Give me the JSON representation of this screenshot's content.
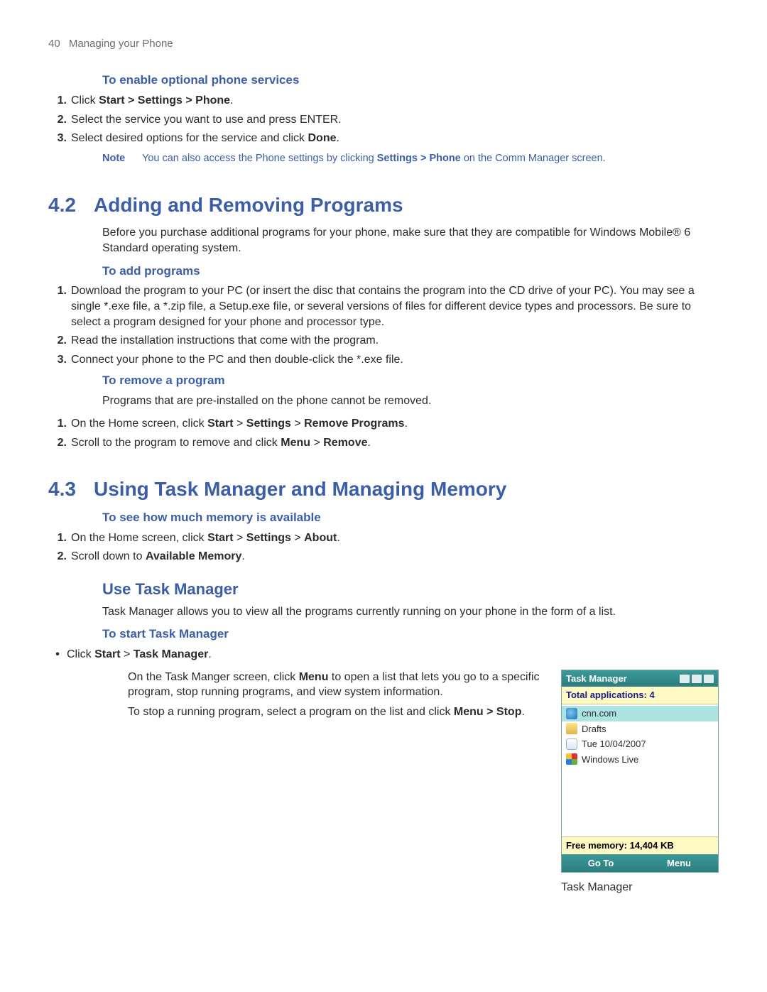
{
  "page": {
    "number": "40",
    "running_title": "Managing your Phone"
  },
  "sec_phone_services": {
    "heading": "To enable optional phone services",
    "steps": [
      {
        "n": "1.",
        "pre": "Click ",
        "bold": "Start > Settings > Phone",
        "post": "."
      },
      {
        "n": "2.",
        "plain": "Select the service you want to use and press ENTER."
      },
      {
        "n": "3.",
        "pre": "Select desired options for the service and click ",
        "bold": "Done",
        "post": "."
      }
    ],
    "note_label": "Note",
    "note_pre": "You can also access the Phone settings by clicking ",
    "note_bold": "Settings > Phone",
    "note_post": " on the Comm Manager screen."
  },
  "sec42": {
    "num": "4.2",
    "title": "Adding and Removing Programs",
    "intro": "Before you purchase additional programs for your phone, make sure that they are compatible for Windows Mobile® 6 Standard operating system.",
    "add_heading": "To add programs",
    "add_steps": [
      {
        "n": "1.",
        "plain": "Download the program to your PC (or insert the disc that contains the program into the CD drive of your PC). You may see a single *.exe file, a *.zip file, a Setup.exe file, or several versions of files for different device types and processors. Be sure to select a program designed for your phone and processor type."
      },
      {
        "n": "2.",
        "plain": "Read the installation instructions that come with the program."
      },
      {
        "n": "3.",
        "plain": "Connect your phone to the PC and then double-click the *.exe file."
      }
    ],
    "remove_heading": "To remove a program",
    "remove_intro": "Programs that are pre-installed on the phone cannot be removed.",
    "remove_steps": [
      {
        "n": "1.",
        "pre": "On the Home screen, click ",
        "bold": "Start",
        "mid1": " > ",
        "bold2": "Settings",
        "mid2": " > ",
        "bold3": "Remove Programs",
        "post": "."
      },
      {
        "n": "2.",
        "pre": "Scroll to the program to remove and click ",
        "bold": "Menu",
        "mid1": " > ",
        "bold2": "Remove",
        "post": "."
      }
    ]
  },
  "sec43": {
    "num": "4.3",
    "title": "Using Task Manager and Managing Memory",
    "mem_heading": "To see how much memory is available",
    "mem_steps": [
      {
        "n": "1.",
        "pre": "On the Home screen, click ",
        "bold": "Start",
        "mid1": " > ",
        "bold2": "Settings",
        "mid2": " > ",
        "bold3": "About",
        "post": "."
      },
      {
        "n": "2.",
        "pre": "Scroll down to ",
        "bold": "Available Memory",
        "post": "."
      }
    ],
    "use_tm_heading": "Use Task Manager",
    "use_tm_intro": "Task Manager allows you to view all the programs currently running on your phone in the form of a list.",
    "start_tm_heading": "To start Task Manager",
    "start_tm_bullet_pre": "Click ",
    "start_tm_bullet_bold": "Start",
    "start_tm_bullet_mid": " > ",
    "start_tm_bullet_bold2": "Task Manager",
    "start_tm_bullet_post": ".",
    "tm_para1_pre": "On the Task Manger screen, click ",
    "tm_para1_bold": "Menu",
    "tm_para1_post": " to open a list that lets you go to a specific program, stop running programs, and view system information.",
    "tm_para2_pre": "To stop a running program, select a program on the list and click ",
    "tm_para2_bold": "Menu > Stop",
    "tm_para2_post": "."
  },
  "screenshot": {
    "title": "Task Manager",
    "total_label": "Total applications: 4",
    "items": [
      {
        "icon": "ie",
        "label": "cnn.com",
        "selected": true
      },
      {
        "icon": "folder",
        "label": "Drafts",
        "selected": false
      },
      {
        "icon": "cal",
        "label": "Tue 10/04/2007",
        "selected": false
      },
      {
        "icon": "flag",
        "label": "Windows Live",
        "selected": false
      }
    ],
    "free_mem": "Free memory: 14,404 KB",
    "softkey_left": "Go To",
    "softkey_right": "Menu",
    "caption": "Task Manager"
  }
}
